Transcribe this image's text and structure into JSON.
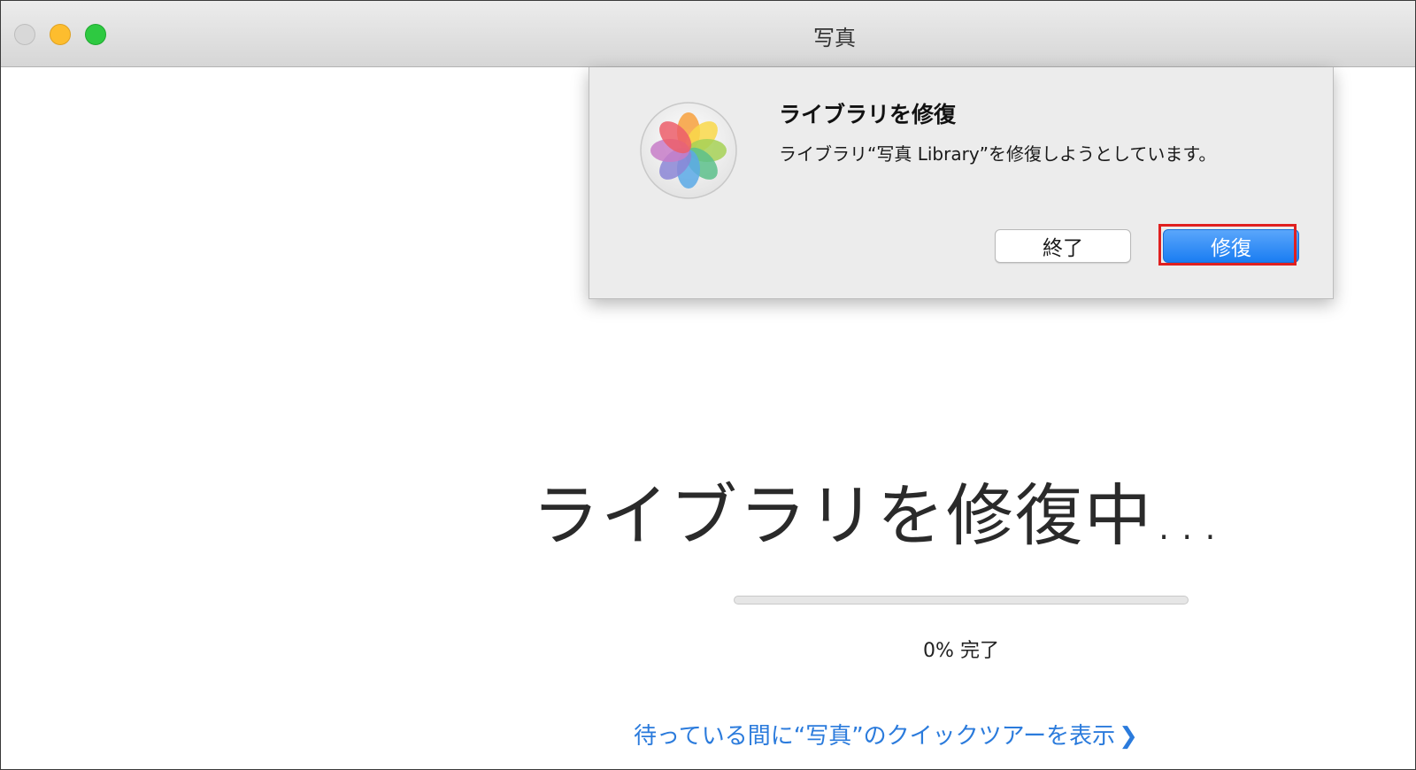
{
  "window": {
    "title": "写真"
  },
  "sheet": {
    "title": "ライブラリを修復",
    "message": "ライブラリ“写真 Library”を修復しようとしています。",
    "quit_label": "終了",
    "repair_label": "修復"
  },
  "main": {
    "heading": "ライブラリを修復中...",
    "progress_percent": 0,
    "progress_text": "0% 完了",
    "tour_link": "待っている間に“写真”のクイックツアーを表示",
    "tour_chevron": "❯"
  },
  "colors": {
    "accent": "#1a7df2",
    "link": "#2b7bdc",
    "highlight": "#e02020"
  },
  "icons": {
    "app": "photos-app-icon",
    "traffic_close": "close-window-icon",
    "traffic_min": "minimize-window-icon",
    "traffic_zoom": "zoom-window-icon"
  }
}
